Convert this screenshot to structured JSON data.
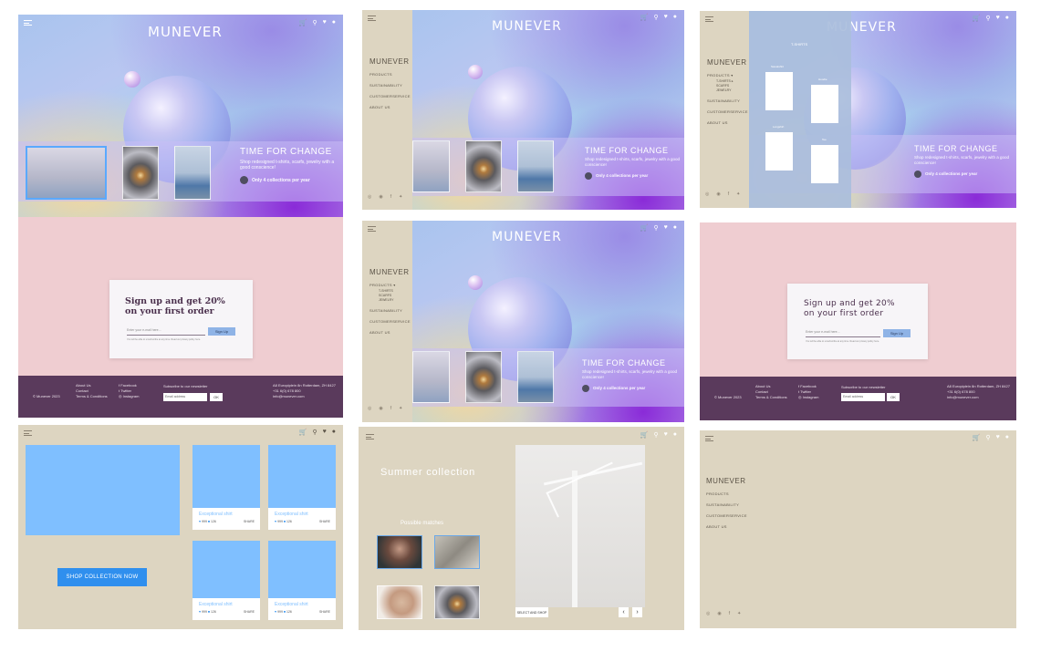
{
  "brand": {
    "name": "MUNEVER"
  },
  "header": {
    "icons": [
      "cart-icon",
      "search-icon",
      "heart-icon",
      "user-icon"
    ]
  },
  "nav": {
    "products": "PRODUCTS",
    "tshirts": "T-SHIRTS",
    "scarfs": "SCARFS",
    "jewelry": "JEWELRY",
    "sustainability": "SUSTAINABILITY",
    "customerservice": "CUSTOMERSERVICE",
    "about": "ABOUT US"
  },
  "hero": {
    "title": "TIME FOR CHANGE",
    "subtitle": "Shop redesigned t-shirts, scarfs, jewelry with a good conscience!",
    "collections_note": "Only 4 collections per year"
  },
  "tshirts_overlay": {
    "title": "T-SHIRTS",
    "items": [
      "Sweatshirt",
      "Hoodie",
      "Longshirt",
      "Tee"
    ]
  },
  "signup": {
    "headline_line1": "Sign up and get 20%",
    "headline_line2": "on your first order",
    "email_placeholder": "Enter your e-mail here...",
    "button": "Sign Up",
    "note": "You will be able to unsubscribe at any time. Read our privacy policy here."
  },
  "footer": {
    "copyright": "© Munever 2023",
    "links": [
      "About Us",
      "Contact",
      "Terms & Conditions"
    ],
    "socials": [
      "Facebook",
      "Twitter",
      "Instagram"
    ],
    "newsletter_label": "Subscribe to our newsletter",
    "newsletter_placeholder": "Email address",
    "newsletter_button": "OK",
    "address": [
      "A8 Europiplein 8n Rotterdam, ZH 8427",
      "+31 6(0) 678 800",
      "info@munever.com"
    ]
  },
  "shop": {
    "button": "SHOP COLLECTION NOW",
    "product_name": "Exceptional shirt",
    "likes": "999",
    "comments": "126",
    "share": "SHARE"
  },
  "summer": {
    "title": "Summer collection",
    "matches": "Possible matches",
    "select_button": "SELECT AND SHOP",
    "prev": "‹",
    "next": "›"
  },
  "colors": {
    "beige": "#ddd5c1",
    "pink": "#efcdd1",
    "footer": "#5a3a5c",
    "blue_card": "#7fbfff",
    "button_blue": "#2f8fee"
  }
}
